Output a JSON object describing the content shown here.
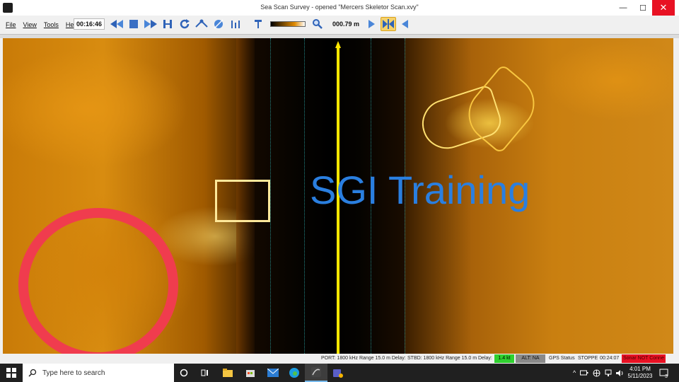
{
  "window": {
    "title": "Sea Scan Survey - opened \"Mercers Skeletor Scan.xvy\"",
    "minimize": "—",
    "maximize": "☐",
    "close": "✕"
  },
  "menu": [
    "File",
    "View",
    "Tools",
    "Help"
  ],
  "toolbar": {
    "time": "00:16:46",
    "range": "000.79 m",
    "buttons": [
      "rewind-icon",
      "stop-icon",
      "fast-forward-icon",
      "mark-icon",
      "reload-icon",
      "waypoint-icon",
      "target-icon",
      "measure-icon",
      "pin-icon",
      "zoom-icon",
      "next-icon",
      "split-view-icon",
      "prev-icon"
    ]
  },
  "sonar": {
    "watermark": "SGI Training"
  },
  "status": {
    "port": "PORT: 1800 kHz  Range 15.0 m  Delay: 0",
    "stbd": "STBD: 1800 kHz  Range 15.0 m  Delay: 0",
    "speed": "1.4 kt",
    "alt": "ALT: NA",
    "gps": "GPS Status",
    "stopped": "STOPPED",
    "time": "00:24:07",
    "sonar": "Sonar NOT Conne"
  },
  "taskbar": {
    "search_placeholder": "Type here to search",
    "time": "4:01 PM",
    "date": "5/11/2023",
    "notifications": "3"
  },
  "colors": {
    "accent": "#2a7fe0",
    "nadir": "#ffe600",
    "circle": "#f03c4e",
    "speed_ok": "#2fd12f",
    "error": "#e81123"
  }
}
